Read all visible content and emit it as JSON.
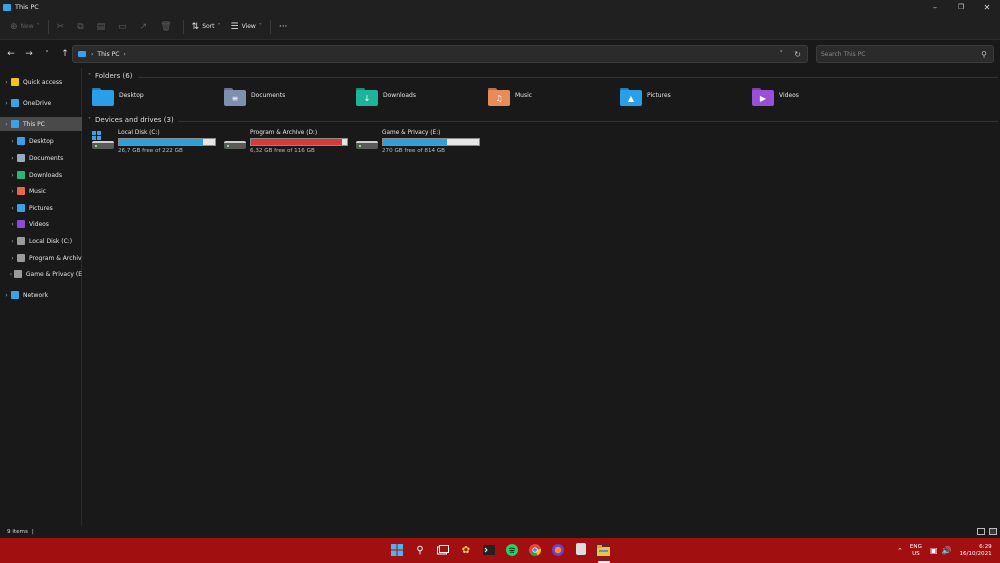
{
  "window": {
    "title": "This PC"
  },
  "toolbar": {
    "new_label": "New",
    "sort_label": "Sort",
    "view_label": "View",
    "more_label": "···"
  },
  "nav": {
    "path": "This PC",
    "search_placeholder": "Search This PC"
  },
  "sidebar": {
    "items": [
      {
        "label": "Quick access",
        "icon": "star-icon",
        "color": "#f0c419"
      },
      {
        "label": "OneDrive",
        "icon": "cloud-icon",
        "color": "#3aa0e8"
      },
      {
        "label": "This PC",
        "icon": "computer-icon",
        "color": "#3aa0e8"
      },
      {
        "label": "Desktop",
        "icon": "desktop-icon",
        "color": "#3aa0e8"
      },
      {
        "label": "Documents",
        "icon": "documents-icon",
        "color": "#9aa8c0"
      },
      {
        "label": "Downloads",
        "icon": "download-icon",
        "color": "#2bb673"
      },
      {
        "label": "Music",
        "icon": "music-icon",
        "color": "#e8664a"
      },
      {
        "label": "Pictures",
        "icon": "pictures-icon",
        "color": "#3aa0e8"
      },
      {
        "label": "Videos",
        "icon": "videos-icon",
        "color": "#8a4bd6"
      },
      {
        "label": "Local Disk (C:)",
        "icon": "drive-icon",
        "color": "#9a9a9a"
      },
      {
        "label": "Program & Archiv",
        "icon": "drive-icon",
        "color": "#9a9a9a"
      },
      {
        "label": "Game & Privacy (E",
        "icon": "drive-icon",
        "color": "#9a9a9a"
      },
      {
        "label": "Network",
        "icon": "network-icon",
        "color": "#3aa0e8"
      }
    ]
  },
  "main": {
    "folders_header": "Folders (6)",
    "drives_header": "Devices and drives (3)",
    "folders": [
      {
        "label": "Desktop",
        "icon": "desktop-folder-icon",
        "color": "#2a9ee6",
        "glyph": ""
      },
      {
        "label": "Documents",
        "icon": "documents-folder-icon",
        "color": "#7f8fb0",
        "glyph": "≡"
      },
      {
        "label": "Downloads",
        "icon": "downloads-folder-icon",
        "color": "#1fb39a",
        "glyph": "↓"
      },
      {
        "label": "Music",
        "icon": "music-folder-icon",
        "color": "#e98a5a",
        "glyph": "♫"
      },
      {
        "label": "Pictures",
        "icon": "pictures-folder-icon",
        "color": "#2a9ee6",
        "glyph": "▲"
      },
      {
        "label": "Videos",
        "icon": "videos-folder-icon",
        "color": "#9a4fd9",
        "glyph": "▶"
      }
    ],
    "drives": [
      {
        "name": "Local Disk (C:)",
        "free": "26,7 GB free of 222 GB",
        "used_fraction": 0.88,
        "bar_color": "#2e9fd8"
      },
      {
        "name": "Program & Archive (D:)",
        "free": "6,32 GB free of 116 GB",
        "used_fraction": 0.95,
        "bar_color": "#d63a3a"
      },
      {
        "name": "Game & Privacy (E:)",
        "free": "270 GB free of 814 GB",
        "used_fraction": 0.67,
        "bar_color": "#2e9fd8"
      }
    ]
  },
  "status": {
    "items": "9 items"
  },
  "taskbar": {
    "apps": [
      "start-icon",
      "search-icon",
      "task-view-icon",
      "paint-icon",
      "terminal-icon",
      "spotify-icon",
      "chrome-icon",
      "firefox-icon",
      "photo-icon",
      "file-explorer-icon"
    ],
    "lang": "ENG",
    "region": "US",
    "time": "6:29",
    "date": "16/10/2021"
  }
}
